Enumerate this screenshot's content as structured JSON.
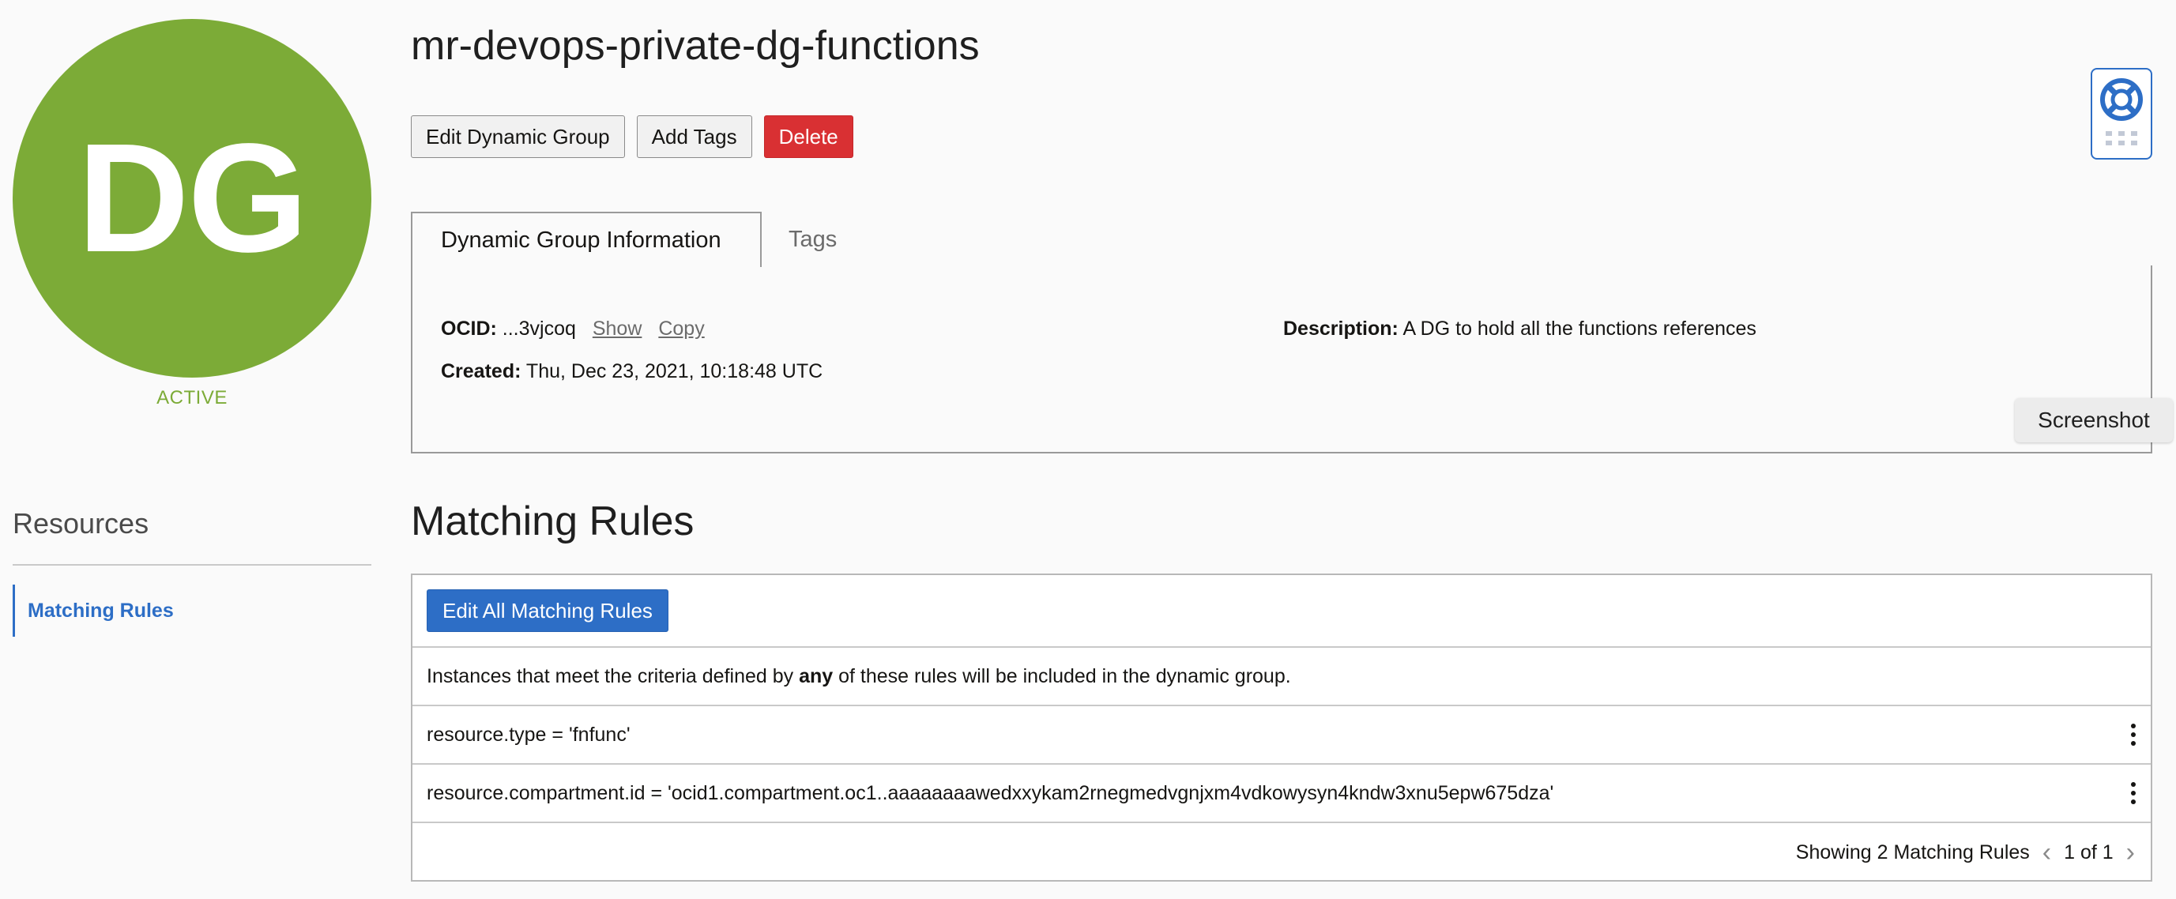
{
  "avatar": {
    "initials": "DG",
    "color": "#7cab37"
  },
  "lifecycle_state": "ACTIVE",
  "title": "mr-devops-private-dg-functions",
  "actions": {
    "edit_label": "Edit Dynamic Group",
    "add_tags_label": "Add Tags",
    "delete_label": "Delete"
  },
  "tabs": [
    {
      "label": "Dynamic Group Information",
      "active": true
    },
    {
      "label": "Tags",
      "active": false
    }
  ],
  "info": {
    "ocid_label": "OCID:",
    "ocid_value": "...3vjcoq",
    "show_link": "Show",
    "copy_link": "Copy",
    "created_label": "Created:",
    "created_value": "Thu, Dec 23, 2021, 10:18:48 UTC",
    "description_label": "Description:",
    "description_value": "A DG to hold all the functions references"
  },
  "resources": {
    "title": "Resources",
    "items": [
      {
        "label": "Matching Rules",
        "active": true
      }
    ]
  },
  "matching_rules": {
    "title": "Matching Rules",
    "edit_button": "Edit All Matching Rules",
    "description_prefix": "Instances that meet the criteria defined by ",
    "description_bold": "any",
    "description_suffix": " of these rules will be included in the dynamic group.",
    "rules": [
      "resource.type = 'fnfunc'",
      "resource.compartment.id = 'ocid1.compartment.oc1..aaaaaaaawedxxykam2rnegmedvgnjxm4vdkowysyn4kndw3xnu5epw675dza'"
    ],
    "footer": {
      "showing": "Showing 2 Matching Rules",
      "page": "1 of 1"
    }
  },
  "screenshot_button": "Screenshot",
  "icons": {
    "help": "lifebuoy-icon",
    "apps": "dots-grid-icon",
    "prev": "chevron-left-icon",
    "next": "chevron-right-icon",
    "kebab": "kebab-menu-icon"
  },
  "colors": {
    "accent": "#2d6ec6",
    "danger": "#d93033",
    "active": "#7cab37"
  }
}
